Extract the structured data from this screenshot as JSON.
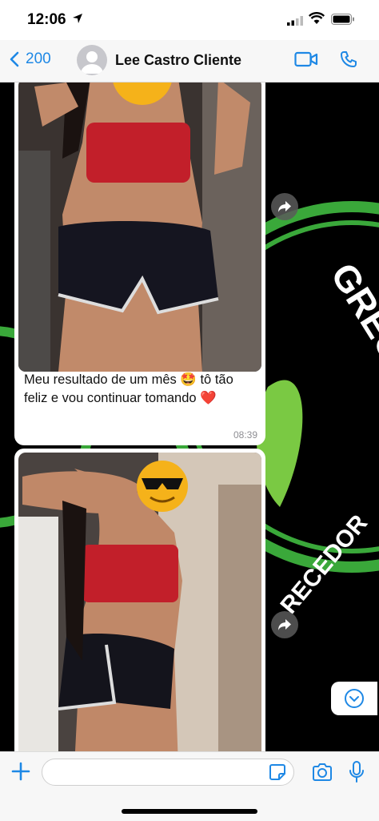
{
  "status_bar": {
    "time": "12:06"
  },
  "header": {
    "back_count": "200",
    "contact_name": "Lee Castro Cliente"
  },
  "messages": [
    {
      "caption": "Meu resultado de um mês 🤩 tô tão feliz e vou continuar tomando ❤️",
      "time": "08:39"
    },
    {
      "caption": "",
      "time": ""
    }
  ],
  "wallpaper_text": {
    "top": "GRECER",
    "bottom": "RECEDOR"
  },
  "composer": {
    "placeholder": ""
  },
  "colors": {
    "accent": "#1e88e5",
    "wallpaper_ring": "#3aa83a",
    "leaf": "#7ac943"
  },
  "icons": [
    "location-arrow-icon",
    "signal-icon",
    "wifi-icon",
    "battery-icon",
    "chevron-left-icon",
    "video-icon",
    "phone-icon",
    "forward-icon",
    "chevron-down-icon",
    "plus-icon",
    "sticker-icon",
    "camera-icon",
    "mic-icon"
  ]
}
